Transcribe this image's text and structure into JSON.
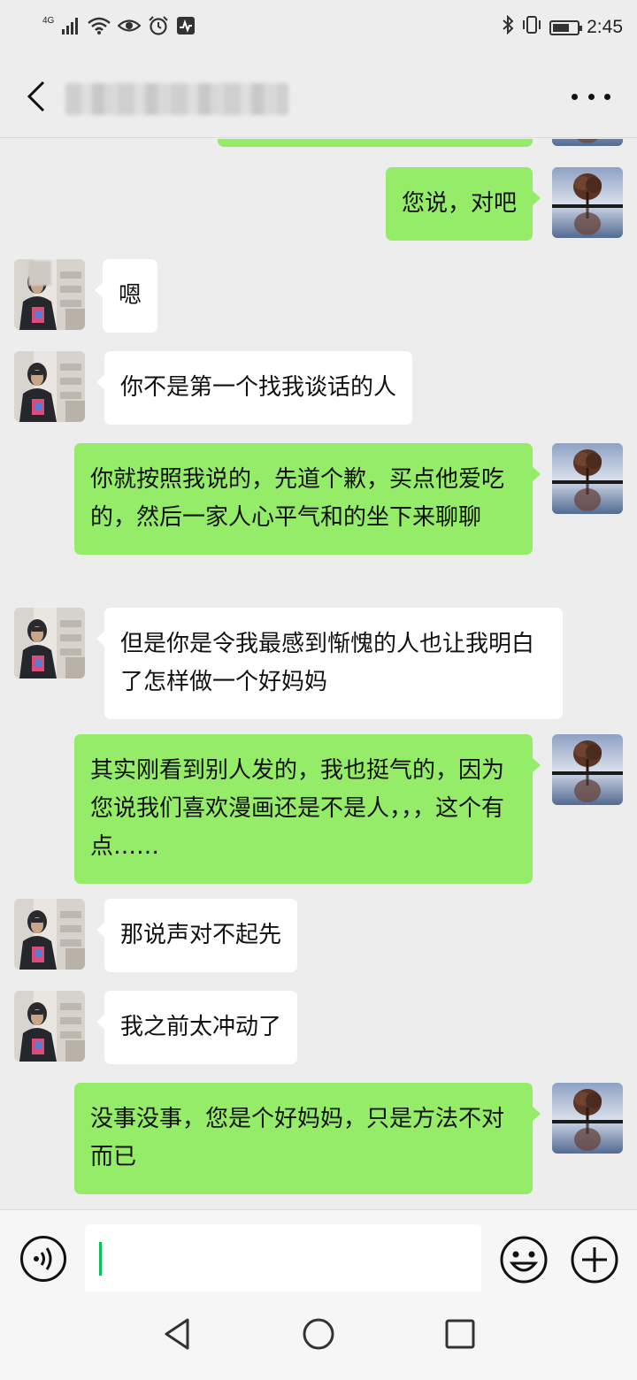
{
  "status_bar": {
    "network": "4G",
    "time": "2:45",
    "battery_level": 0.7
  },
  "header": {
    "title": "",
    "back_icon": "chevron-left-icon",
    "more_icon": "more-dots-icon"
  },
  "messages": [
    {
      "side": "out",
      "text": "",
      "partial": true
    },
    {
      "side": "out",
      "text": "您说，对吧"
    },
    {
      "side": "in",
      "text": "嗯"
    },
    {
      "side": "in",
      "text": "你不是第一个找我谈话的人"
    },
    {
      "side": "out",
      "text": "你就按照我说的，先道个歉，买点他爱吃的，然后一家人心平气和的坐下来聊聊"
    },
    {
      "side": "in",
      "text": "但是你是令我最感到惭愧的人也让我明白了怎样做一个好妈妈"
    },
    {
      "side": "out",
      "text": "其实刚看到别人发的，我也挺气的，因为您说我们喜欢漫画还是不是人，，，这个有点……"
    },
    {
      "side": "in",
      "text": "那说声对不起先"
    },
    {
      "side": "in",
      "text": "我之前太冲动了"
    },
    {
      "side": "out",
      "text": "没事没事，您是个好妈妈，只是方法不对而已"
    }
  ],
  "input": {
    "value": "",
    "voice_icon": "voice-icon",
    "emoji_icon": "emoji-icon",
    "plus_icon": "plus-icon"
  },
  "nav": {
    "back_icon": "nav-back-icon",
    "home_icon": "nav-home-icon",
    "recent_icon": "nav-recent-icon"
  },
  "colors": {
    "background": "#ededed",
    "outgoing_bubble": "#95ec69",
    "incoming_bubble": "#ffffff",
    "cursor": "#07c160"
  }
}
